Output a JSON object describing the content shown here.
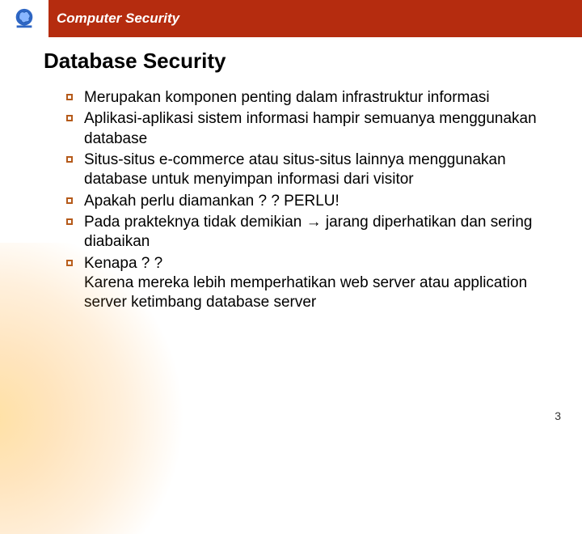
{
  "header": {
    "course_title": "Computer Security"
  },
  "slide": {
    "title": "Database Security",
    "bullets": [
      "Merupakan komponen penting dalam infrastruktur informasi",
      "Aplikasi-aplikasi sistem informasi hampir semuanya menggunakan database",
      "Situs-situs e-commerce atau situs-situs lainnya menggunakan database untuk menyimpan informasi dari visitor",
      "Apakah perlu diamankan ? ?  PERLU!",
      "Pada prakteknya tidak demikian → jarang diperhatikan dan sering diabaikan",
      "Kenapa ? ?\nKarena mereka lebih memperhatikan web server atau application server ketimbang database server"
    ],
    "page_number": "3"
  }
}
